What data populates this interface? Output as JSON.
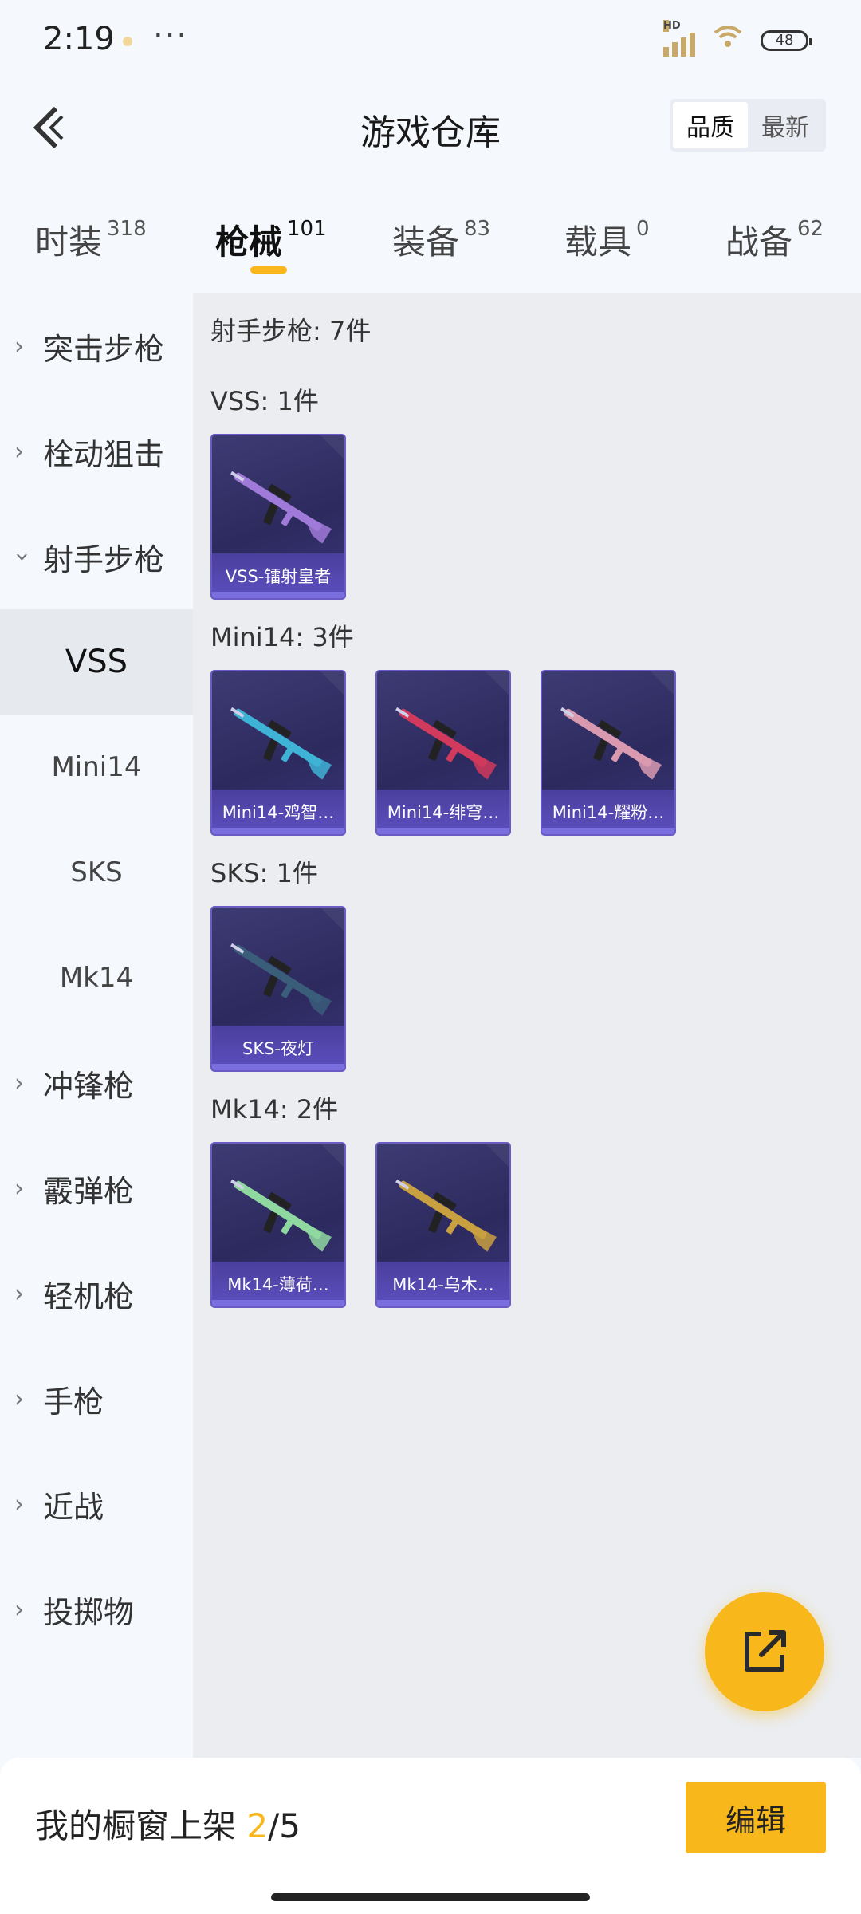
{
  "status": {
    "time": "2:19",
    "more": "···",
    "signal_tag": "HD",
    "battery": "48"
  },
  "header": {
    "title": "游戏仓库",
    "sort": [
      "品质",
      "最新"
    ]
  },
  "tabs": [
    {
      "label": "时装",
      "count": "318"
    },
    {
      "label": "枪械",
      "count": "101"
    },
    {
      "label": "装备",
      "count": "83"
    },
    {
      "label": "载具",
      "count": "0"
    },
    {
      "label": "战备",
      "count": "62"
    }
  ],
  "sidebar": {
    "items": [
      "突击步枪",
      "栓动狙击",
      "射手步枪",
      "冲锋枪",
      "霰弹枪",
      "轻机枪",
      "手枪",
      "近战",
      "投掷物"
    ],
    "sub_items": [
      "VSS",
      "Mini14",
      "SKS",
      "Mk14"
    ]
  },
  "content": {
    "category_title": "射手步枪: 7件",
    "groups": [
      {
        "title": "VSS: 1件",
        "items": [
          "VSS-镭射皇者"
        ]
      },
      {
        "title": "Mini14: 3件",
        "items": [
          "Mini14-鸡智…",
          "Mini14-绯穹…",
          "Mini14-耀粉…"
        ]
      },
      {
        "title": "SKS: 1件",
        "items": [
          "SKS-夜灯"
        ]
      },
      {
        "title": "Mk14: 2件",
        "items": [
          "Mk14-薄荷…",
          "Mk14-乌木…"
        ]
      }
    ]
  },
  "weapon_colors": [
    "#a07ad8",
    "#3fb3d6",
    "#d13a5c",
    "#d99ab0",
    "#3a5d7a",
    "#8fd8a0",
    "#c9a040"
  ],
  "bottom": {
    "showcase_label": "我的橱窗上架 ",
    "current": "2",
    "total": "/5",
    "edit": "编辑"
  },
  "accent": "#f8b81b"
}
